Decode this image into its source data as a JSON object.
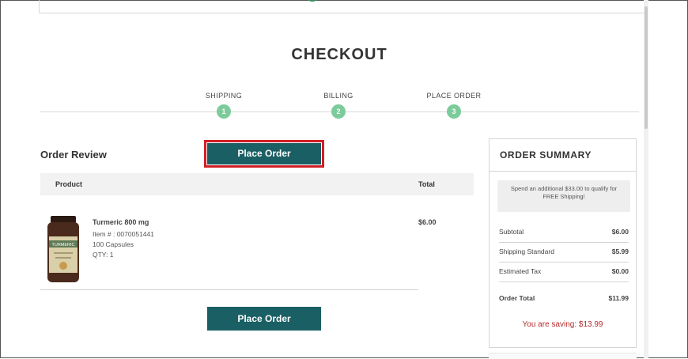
{
  "page": {
    "title": "CHECKOUT"
  },
  "steps": [
    {
      "label": "SHIPPING",
      "number": "1"
    },
    {
      "label": "BILLING",
      "number": "2"
    },
    {
      "label": "PLACE ORDER",
      "number": "3"
    }
  ],
  "order_review": {
    "heading": "Order Review",
    "place_order_label": "Place Order",
    "table": {
      "col_product": "Product",
      "col_total": "Total"
    },
    "item": {
      "name": "Turmeric 800 mg",
      "item_number": "Item # : 0070051441",
      "size": "100 Capsules",
      "qty": "QTY: 1",
      "price": "$6.00",
      "image_label": "TURMERIC"
    }
  },
  "summary": {
    "title": "ORDER SUMMARY",
    "free_shipping_note": "Spend an additional $33.00 to qualify for FREE Shipping!",
    "rows": [
      {
        "label": "Subtotal",
        "value": "$6.00"
      },
      {
        "label": "Shipping Standard",
        "value": "$5.99"
      },
      {
        "label": "Estimated Tax",
        "value": "$0.00"
      },
      {
        "label": "Order Total",
        "value": "$11.99"
      }
    ],
    "saving": "You are saving: $13.99"
  },
  "colors": {
    "primary_button": "#1a5f64",
    "step_circle": "#7ccb9a",
    "highlight_border": "#d21e26",
    "saving_text": "#b22b2b"
  }
}
